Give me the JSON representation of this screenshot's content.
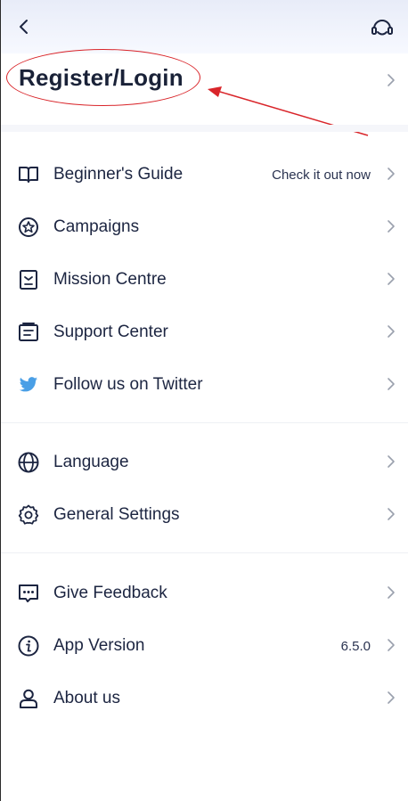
{
  "header": {
    "back_icon": "chevron-left-icon",
    "support_icon": "headset-icon"
  },
  "login": {
    "title": "Register/Login"
  },
  "menu_group_1": [
    {
      "label": "Beginner's Guide",
      "value": "Check it out now",
      "icon": "book-icon"
    },
    {
      "label": "Campaigns",
      "icon": "star-badge-icon"
    },
    {
      "label": "Mission Centre",
      "icon": "mission-icon"
    },
    {
      "label": "Support Center",
      "icon": "document-icon"
    },
    {
      "label": "Follow us on Twitter",
      "icon": "twitter-icon"
    }
  ],
  "menu_group_2": [
    {
      "label": "Language",
      "icon": "globe-icon"
    },
    {
      "label": "General Settings",
      "icon": "gear-icon"
    }
  ],
  "menu_group_3": [
    {
      "label": "Give Feedback",
      "icon": "feedback-icon"
    },
    {
      "label": "App Version",
      "value": "6.5.0",
      "icon": "info-icon"
    },
    {
      "label": "About us",
      "icon": "person-icon"
    }
  ],
  "colors": {
    "text": "#1c2541",
    "chevron": "#9aa0ad",
    "twitter": "#4a9fe6",
    "annotation": "#d9252a"
  }
}
